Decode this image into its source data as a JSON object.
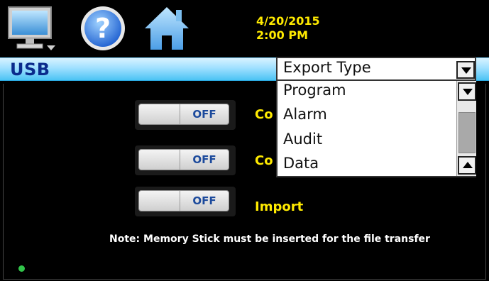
{
  "status": {
    "date": "4/20/2015",
    "time": "2:00 PM"
  },
  "toolbar": {
    "icons": [
      "monitor-icon",
      "help-icon",
      "home-icon"
    ],
    "help_symbol": "?"
  },
  "header": {
    "title": "USB"
  },
  "toggles": [
    {
      "state": "OFF",
      "label": "Co"
    },
    {
      "state": "OFF",
      "label": "Co"
    },
    {
      "state": "OFF",
      "label": "Import"
    }
  ],
  "note": "Note: Memory Stick must be inserted for the file transfer",
  "dropdown": {
    "selected": "Export Type",
    "options": [
      "Program",
      "Alarm",
      "Audit",
      "Data"
    ]
  },
  "colors": {
    "label_yellow": "#ffea00",
    "header_blue": "#4cc3f4",
    "title_navy": "#0b2b8c",
    "toggle_text": "#1c4a9c",
    "status_green": "#31c44a"
  }
}
